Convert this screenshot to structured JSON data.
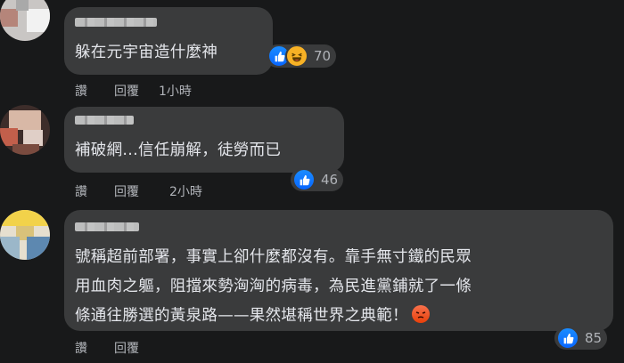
{
  "comments": [
    {
      "text_lines": [
        "躲在元宇宙造什麼神"
      ],
      "reactions": {
        "icons": [
          "like-icon",
          "haha-icon"
        ],
        "count": "70"
      },
      "actions": {
        "like": "讚",
        "reply": "回覆",
        "time": "1小時"
      }
    },
    {
      "text_lines": [
        "補破網...信任崩解，徒勞而已"
      ],
      "reactions": {
        "icons": [
          "like-icon"
        ],
        "count": "46"
      },
      "actions": {
        "like": "讚",
        "reply": "回覆",
        "time": "2小時"
      }
    },
    {
      "text_lines": [
        "號稱超前部署，事實上卻什麼都沒有。靠手無寸鐵的民眾",
        "用血肉之軀，阻擋來勢洶洶的病毒，為民進黨鋪就了一條",
        "條通往勝選的黃泉路——果然堪稱世界之典範！"
      ],
      "inline_emoji": "angry-icon",
      "reactions": {
        "icons": [
          "like-icon"
        ],
        "count": "85"
      },
      "actions": {
        "like": "讚",
        "reply": "回覆",
        "time": ""
      }
    }
  ],
  "colors": {
    "background": "#18191a",
    "bubble": "#3a3b3c",
    "text": "#e4e6eb",
    "muted": "#b0b3b8",
    "like": "#0866ff"
  }
}
